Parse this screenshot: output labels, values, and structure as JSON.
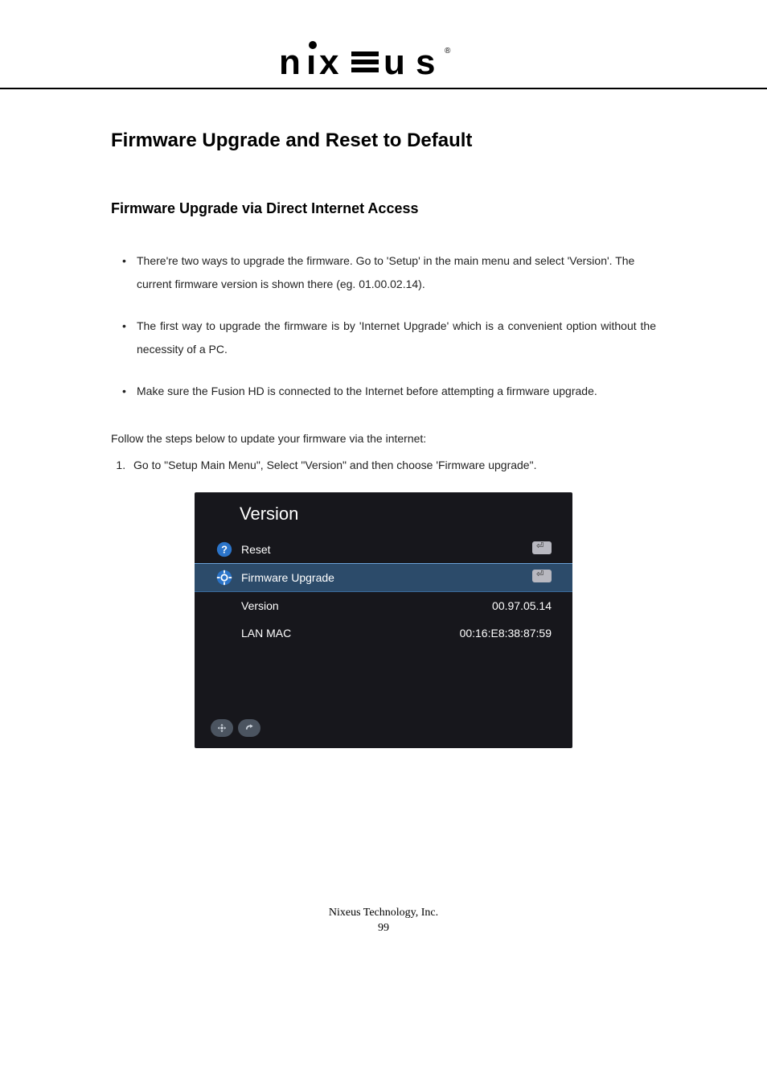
{
  "header": {
    "brand": "nixeus"
  },
  "content": {
    "title_main": "Firmware Upgrade and Reset to Default",
    "title_sub": "Firmware Upgrade via Direct Internet Access",
    "bullets": [
      "There're two ways to upgrade the firmware. Go to 'Setup' in the main menu and select 'Version'. The current firmware version is shown there (eg. 01.00.02.14).",
      "The first way to upgrade the firmware is by 'Internet Upgrade' which is a convenient option without the necessity of a PC.",
      "Make sure the Fusion HD is connected to the Internet before attempting a firmware upgrade."
    ],
    "follow_text": "Follow the steps below to update your firmware via the internet:",
    "steps": [
      "Go to \"Setup Main Menu\", Select \"Version\" and then choose 'Firmware upgrade\"."
    ]
  },
  "screen": {
    "title": "Version",
    "rows": [
      {
        "icon": "question",
        "label": "Reset",
        "type": "enter",
        "selected": false
      },
      {
        "icon": "gear",
        "label": "Firmware Upgrade",
        "type": "enter",
        "selected": true
      },
      {
        "icon": "none",
        "label": "Version",
        "type": "value",
        "value": "00.97.05.14",
        "selected": false
      },
      {
        "icon": "none",
        "label": "LAN MAC",
        "type": "value",
        "value": "00:16:E8:38:87:59",
        "selected": false
      }
    ]
  },
  "footer": {
    "company": "Nixeus Technology, Inc.",
    "page_number": "99"
  }
}
